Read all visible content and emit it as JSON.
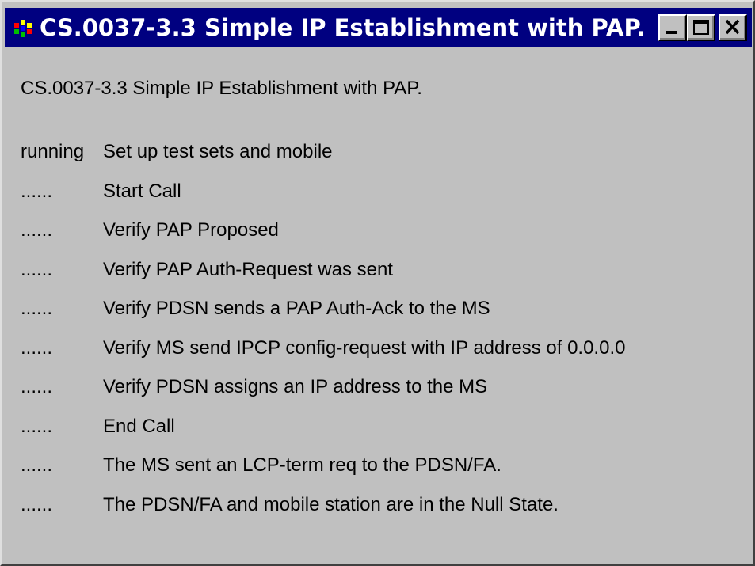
{
  "window": {
    "title": "CS.0037-3.3 Simple IP Establishment with PAP.",
    "icon": "app-icon",
    "buttons": {
      "minimize": "minimize-icon",
      "maximize": "maximize-icon",
      "close": "close-icon"
    }
  },
  "content": {
    "heading": "CS.0037-3.3 Simple IP Establishment with PAP.",
    "steps": [
      {
        "status": "running",
        "label": "Set up test sets and mobile"
      },
      {
        "status": "......",
        "label": "Start Call"
      },
      {
        "status": "......",
        "label": "Verify PAP Proposed"
      },
      {
        "status": "......",
        "label": "Verify PAP Auth-Request was sent"
      },
      {
        "status": "......",
        "label": "Verify PDSN sends a PAP Auth-Ack to the MS"
      },
      {
        "status": "......",
        "label": "Verify MS send IPCP config-request with IP address of 0.0.0.0"
      },
      {
        "status": "......",
        "label": "Verify PDSN assigns an IP address to the MS"
      },
      {
        "status": "......",
        "label": "End Call"
      },
      {
        "status": "......",
        "label": "The MS sent an LCP-term req to the PDSN/FA."
      },
      {
        "status": "......",
        "label": "The PDSN/FA and mobile station are in the Null State."
      }
    ]
  },
  "colors": {
    "titlebar": "#000080",
    "window_background": "#c0c0c0",
    "text": "#000000"
  }
}
